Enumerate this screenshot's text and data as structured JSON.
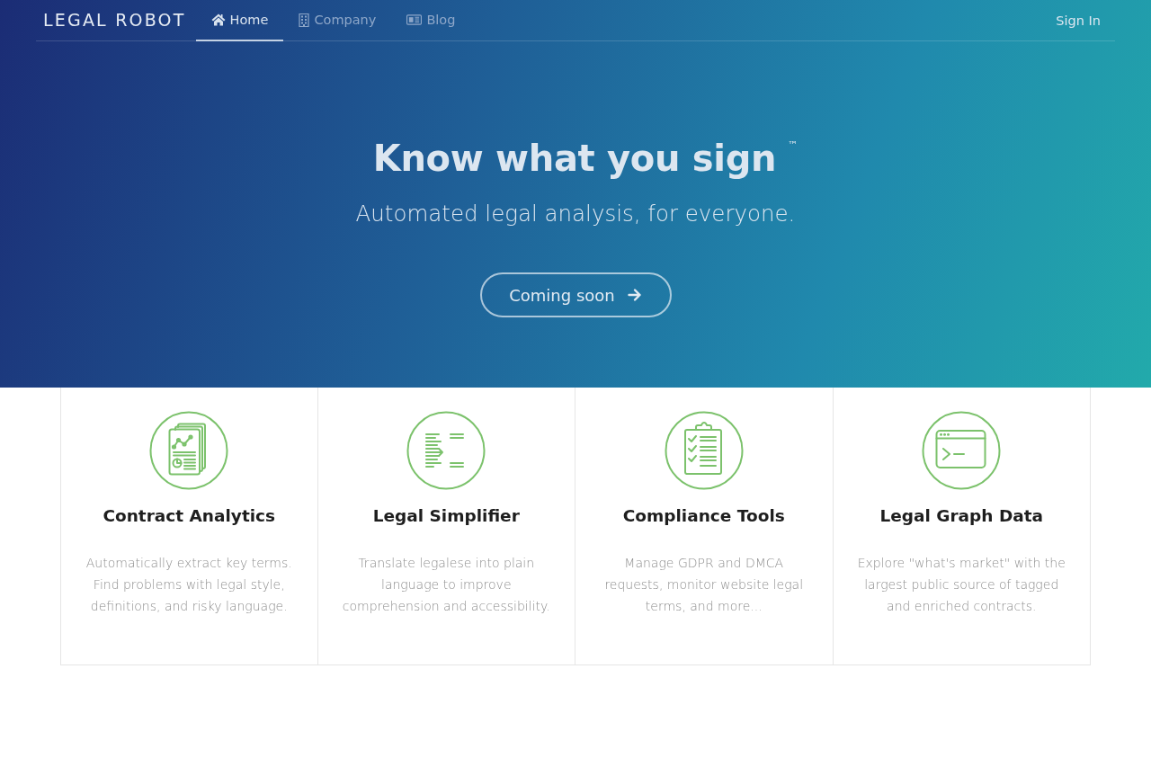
{
  "nav": {
    "logo": "LEGAL ROBOT",
    "items": [
      {
        "label": "Home",
        "selected": true
      },
      {
        "label": "Company",
        "selected": false
      },
      {
        "label": "Blog",
        "selected": false
      }
    ],
    "sign_in": "Sign In"
  },
  "hero": {
    "title": "Know what you sign",
    "trademark": "™",
    "subtitle": "Automated legal analysis, for everyone.",
    "button": "Coming soon"
  },
  "features": [
    {
      "title": "Contract Analytics",
      "description": "Automatically extract key terms. Find problems with legal style, definitions, and risky language."
    },
    {
      "title": "Legal Simplifier",
      "description": "Translate legalese into plain language to improve comprehension and accessibility."
    },
    {
      "title": "Compliance Tools",
      "description": "Manage GDPR and DMCA requests, monitor website legal terms, and more..."
    },
    {
      "title": "Legal Graph Data",
      "description": "Explore \"what's market\" with the largest public source of tagged and enriched contracts."
    }
  ]
}
